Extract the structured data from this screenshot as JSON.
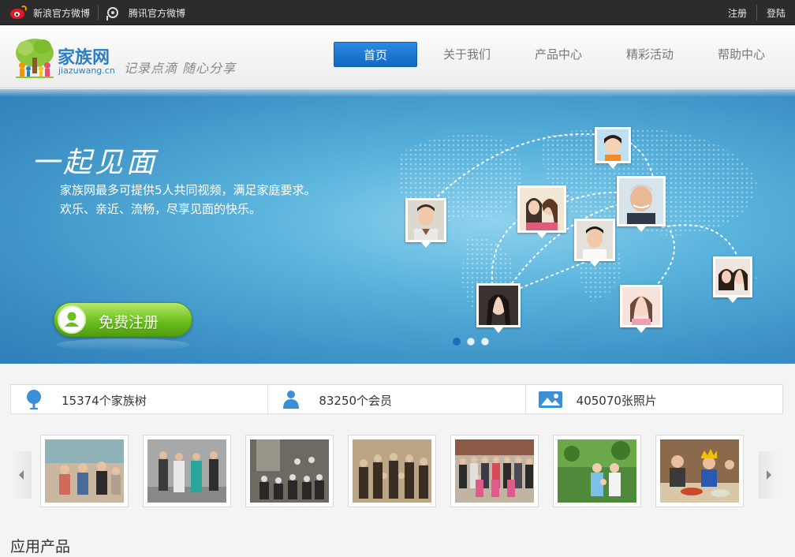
{
  "topbar": {
    "sina_label": "新浪官方微博",
    "tencent_label": "腾讯官方微博",
    "register": "注册",
    "login": "登陆"
  },
  "header": {
    "logo_name": "家族网",
    "logo_url": "jiazuwang.cn",
    "slogan": "记录点滴 随心分享",
    "nav": [
      "首页",
      "关于我们",
      "产品中心",
      "精彩活动",
      "帮助中心"
    ],
    "active_nav": "首页"
  },
  "banner": {
    "headline": "一起见面",
    "desc_line1": "家族网最多可提供5人共同视频，满足家庭要求。",
    "desc_line2": "欢乐、亲近、流畅，尽享见面的快乐。",
    "register_button": "免费注册",
    "slide_count": 3,
    "active_slide": 1
  },
  "stats": [
    {
      "icon": "tree-icon",
      "text": "15374个家族树"
    },
    {
      "icon": "member-icon",
      "text": "83250个会员"
    },
    {
      "icon": "photo-icon",
      "text": "405070张照片"
    }
  ],
  "gallery": {
    "photo_count": 7,
    "prev_icon": "chevron-left-icon",
    "next_icon": "chevron-right-icon"
  },
  "section": {
    "title": "应用产品"
  },
  "colors": {
    "accent_blue": "#1f75cb",
    "register_green": "#6bbf1e",
    "topbar_bg": "#2c2c2c",
    "banner_blue": "#59b3dc"
  }
}
